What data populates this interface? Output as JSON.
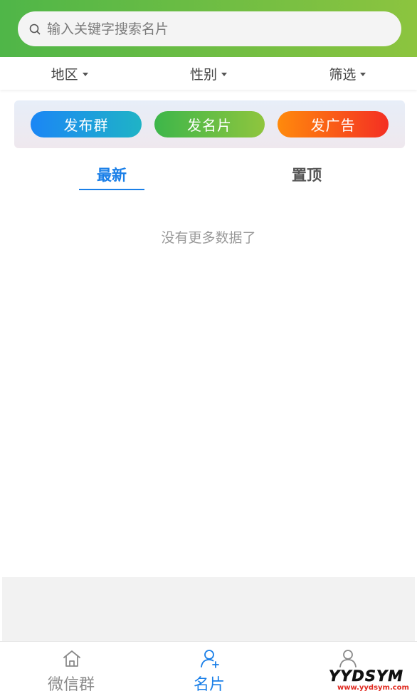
{
  "search": {
    "placeholder": "输入关键字搜索名片"
  },
  "filters": [
    {
      "label": "地区"
    },
    {
      "label": "性别"
    },
    {
      "label": "筛选"
    }
  ],
  "actions": [
    {
      "label": "发布群"
    },
    {
      "label": "发名片"
    },
    {
      "label": "发广告"
    }
  ],
  "tabs": [
    {
      "label": "最新",
      "active": true
    },
    {
      "label": "置顶",
      "active": false
    }
  ],
  "list": {
    "empty_text": "没有更多数据了"
  },
  "bottom_nav": [
    {
      "label": "微信群",
      "icon": "home-icon"
    },
    {
      "label": "名片",
      "icon": "add-user-icon",
      "active": true
    },
    {
      "label": "",
      "icon": "user-icon"
    }
  ],
  "watermark": {
    "brand": "YYDSYM",
    "url": "www.yydsym.com"
  },
  "colors": {
    "header_start": "#4fb648",
    "header_end": "#8cc43f",
    "accent": "#1a7fe8"
  }
}
